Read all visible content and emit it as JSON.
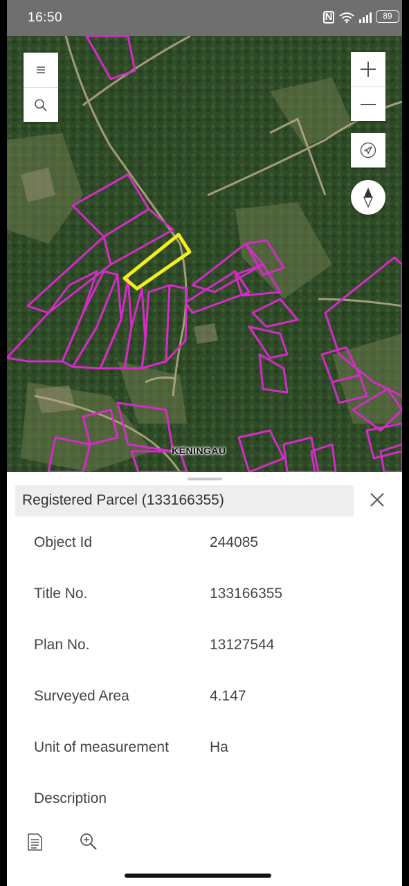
{
  "status_bar": {
    "time": "16:50",
    "nfc_glyph": "N",
    "battery": "89"
  },
  "map": {
    "place_label": "KENINGAU",
    "menu_icon": "hamburger-icon",
    "search_icon": "search-icon",
    "zoom_in_icon": "plus-icon",
    "zoom_out_icon": "minus-icon",
    "locate_icon": "navigation-arrow-icon",
    "compass_icon": "compass-icon",
    "colors": {
      "parcel_outline": "#d62bc8",
      "selected_parcel": "#f4ef1e",
      "vegetation": "#2f4a28"
    }
  },
  "panel": {
    "title": "Registered Parcel (133166355)",
    "close_icon": "close-icon",
    "rows": [
      {
        "label": "Object Id",
        "value": "244085"
      },
      {
        "label": "Title No.",
        "value": "133166355"
      },
      {
        "label": "Plan No.",
        "value": "13127544"
      },
      {
        "label": "Surveyed Area",
        "value": "4.147"
      },
      {
        "label": "Unit of measurement",
        "value": "Ha"
      },
      {
        "label": "Description",
        "value": ""
      }
    ],
    "footer_icons": [
      "document-icon",
      "zoom-to-icon"
    ]
  }
}
